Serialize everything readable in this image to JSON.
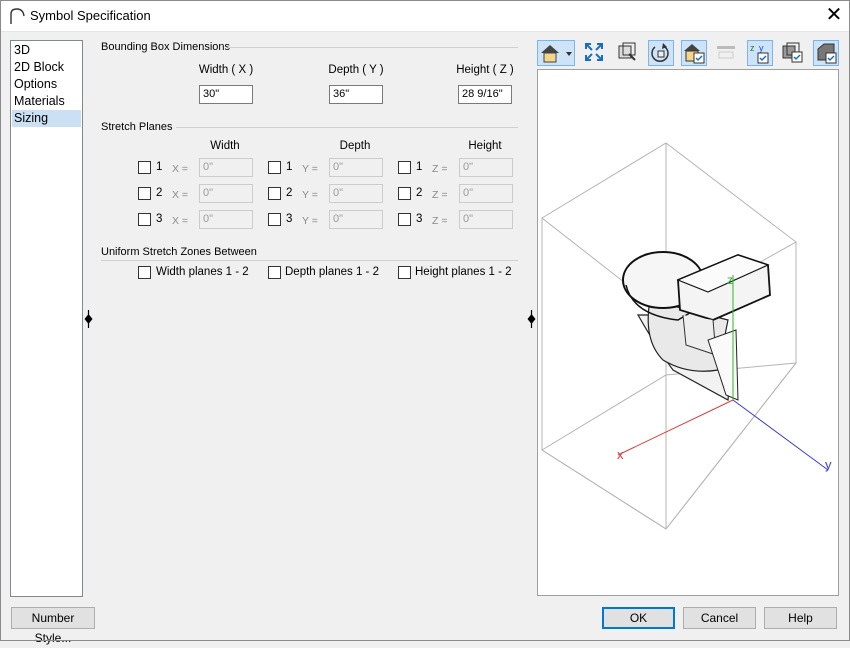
{
  "window": {
    "title": "Symbol Specification",
    "close_glyph": "✕"
  },
  "nav": {
    "items": [
      "3D",
      "2D Block",
      "Options",
      "Materials",
      "Sizing"
    ],
    "selected": "Sizing"
  },
  "bbox": {
    "group_label": "Bounding Box Dimensions",
    "width_label": "Width ( X )",
    "depth_label": "Depth ( Y )",
    "height_label": "Height ( Z )",
    "width_value": "30\"",
    "depth_value": "36\"",
    "height_value": "28 9/16\""
  },
  "stretch": {
    "group_label": "Stretch Planes",
    "width_header": "Width",
    "depth_header": "Depth",
    "height_header": "Height",
    "x_label": "X =",
    "y_label": "Y =",
    "z_label": "Z =",
    "row_nums": [
      "1",
      "2",
      "3"
    ],
    "width_values": [
      "0\"",
      "0\"",
      "0\""
    ],
    "depth_values": [
      "0\"",
      "0\"",
      "0\""
    ],
    "height_values": [
      "0\"",
      "0\"",
      "0\""
    ]
  },
  "zones": {
    "group_label": "Uniform Stretch Zones Between",
    "width_planes": "Width planes 1 - 2",
    "depth_planes": "Depth planes 1 - 2",
    "height_planes": "Height planes 1 - 2"
  },
  "viewer": {
    "axis_x": "x",
    "axis_y": "y",
    "axis_z": "z",
    "axis_colors": {
      "x": "#e03a3a",
      "y": "#3a3ae0",
      "z": "#2ab82a"
    }
  },
  "toolbar": {
    "icons": [
      "render-mode-icon",
      "fill-window-icon",
      "camera-view-icon",
      "rotate-view-icon",
      "symbol-origin-icon",
      "stretch-plane-icon",
      "axes-toggle-icon",
      "bounding-box-icon",
      "orthographic-icon"
    ]
  },
  "buttons": {
    "number_style": "Number Style...",
    "ok": "OK",
    "cancel": "Cancel",
    "help": "Help"
  },
  "accent": "#0078d7"
}
